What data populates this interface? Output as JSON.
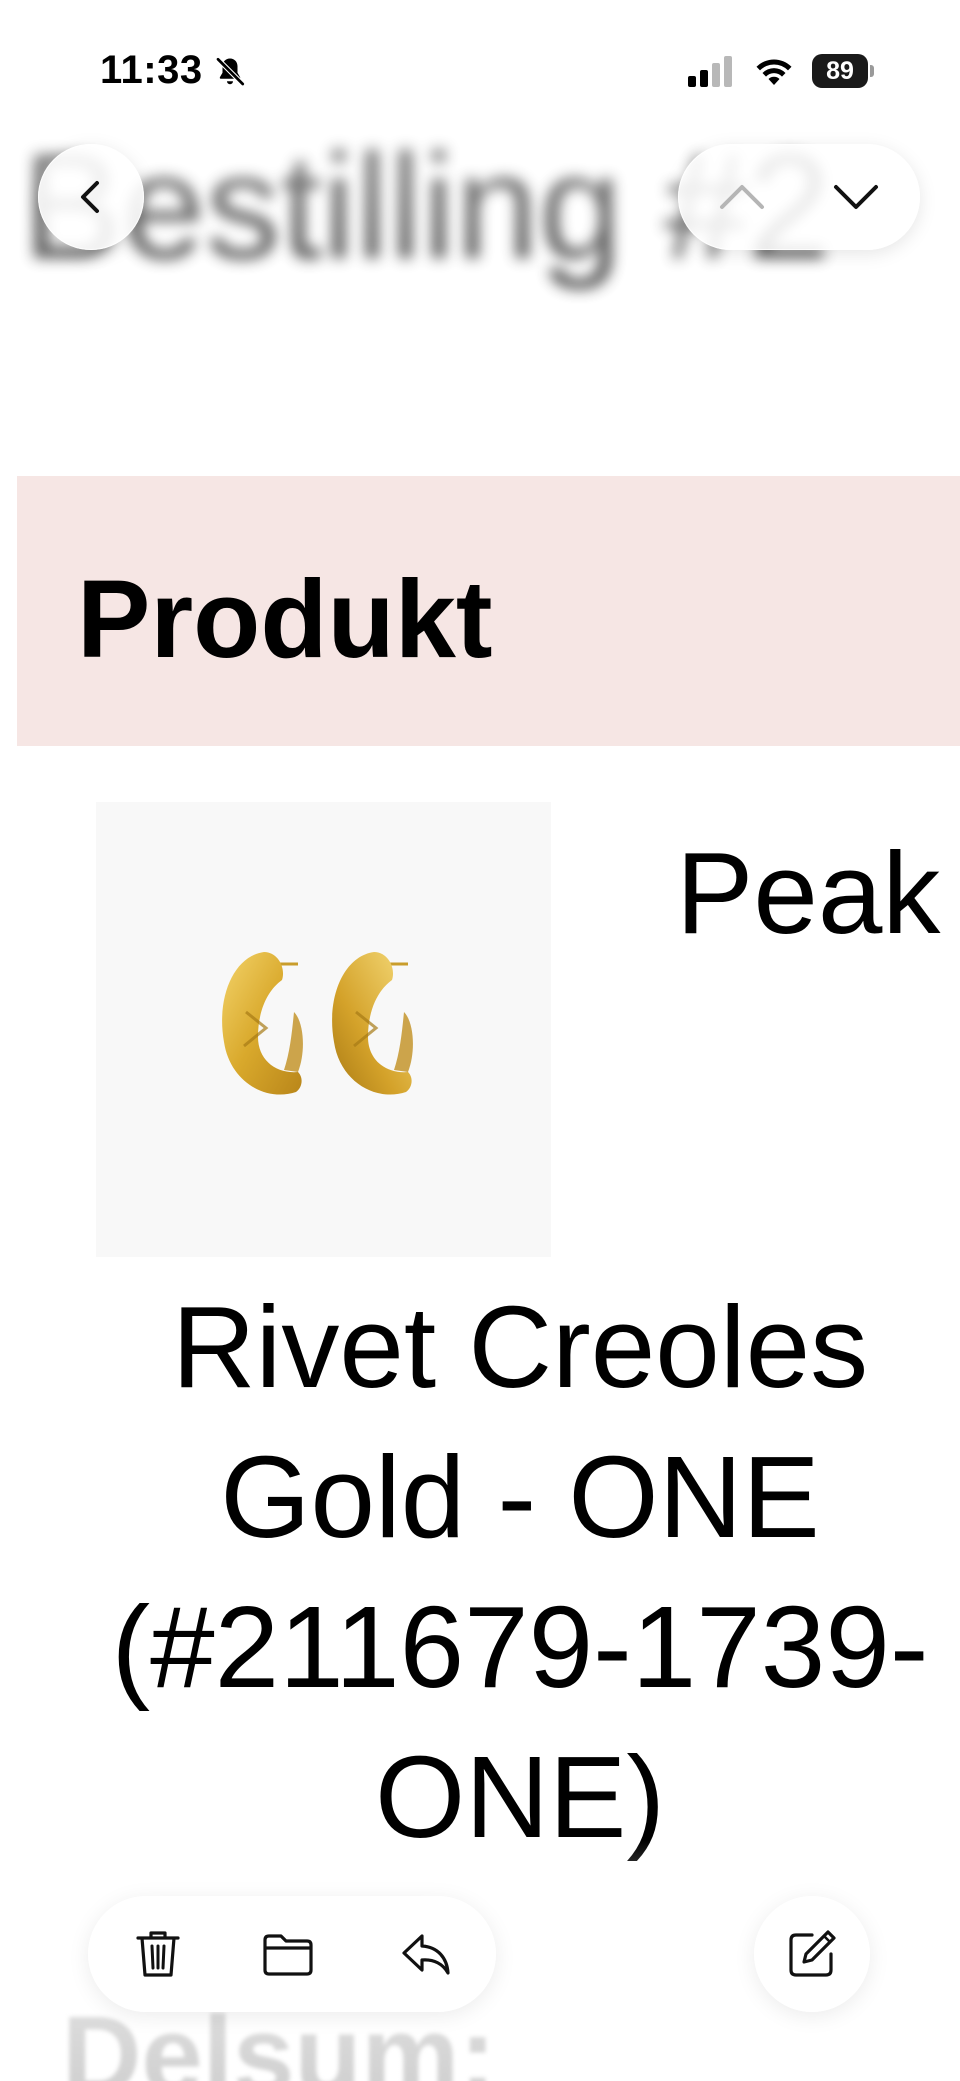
{
  "status_bar": {
    "time": "11:33",
    "battery": "89",
    "icons": [
      "bell-slash-icon",
      "cellular-signal-icon",
      "wifi-icon",
      "battery-icon"
    ]
  },
  "header": {
    "title": "Bestilling #2",
    "back_icon": "chevron-left-icon",
    "previous_icon": "chevron-up-icon",
    "next_icon": "chevron-down-icon"
  },
  "order": {
    "section_title": "Produkt",
    "product_name_first_word": "Peak",
    "product_name_lines": [
      "Rivet Creoles",
      "Gold - ONE",
      "(#211679-1739-",
      "ONE)"
    ],
    "product_image": "gold-hoop-earrings",
    "subtotal_label": "Delsum:"
  },
  "toolbar": {
    "delete_icon": "trash-icon",
    "move_icon": "folder-icon",
    "reply_icon": "reply-icon",
    "compose_icon": "compose-icon"
  },
  "colors": {
    "banner_background": "#f6e6e4",
    "image_background": "#f8f8f8",
    "gold": "#d9a92c"
  }
}
